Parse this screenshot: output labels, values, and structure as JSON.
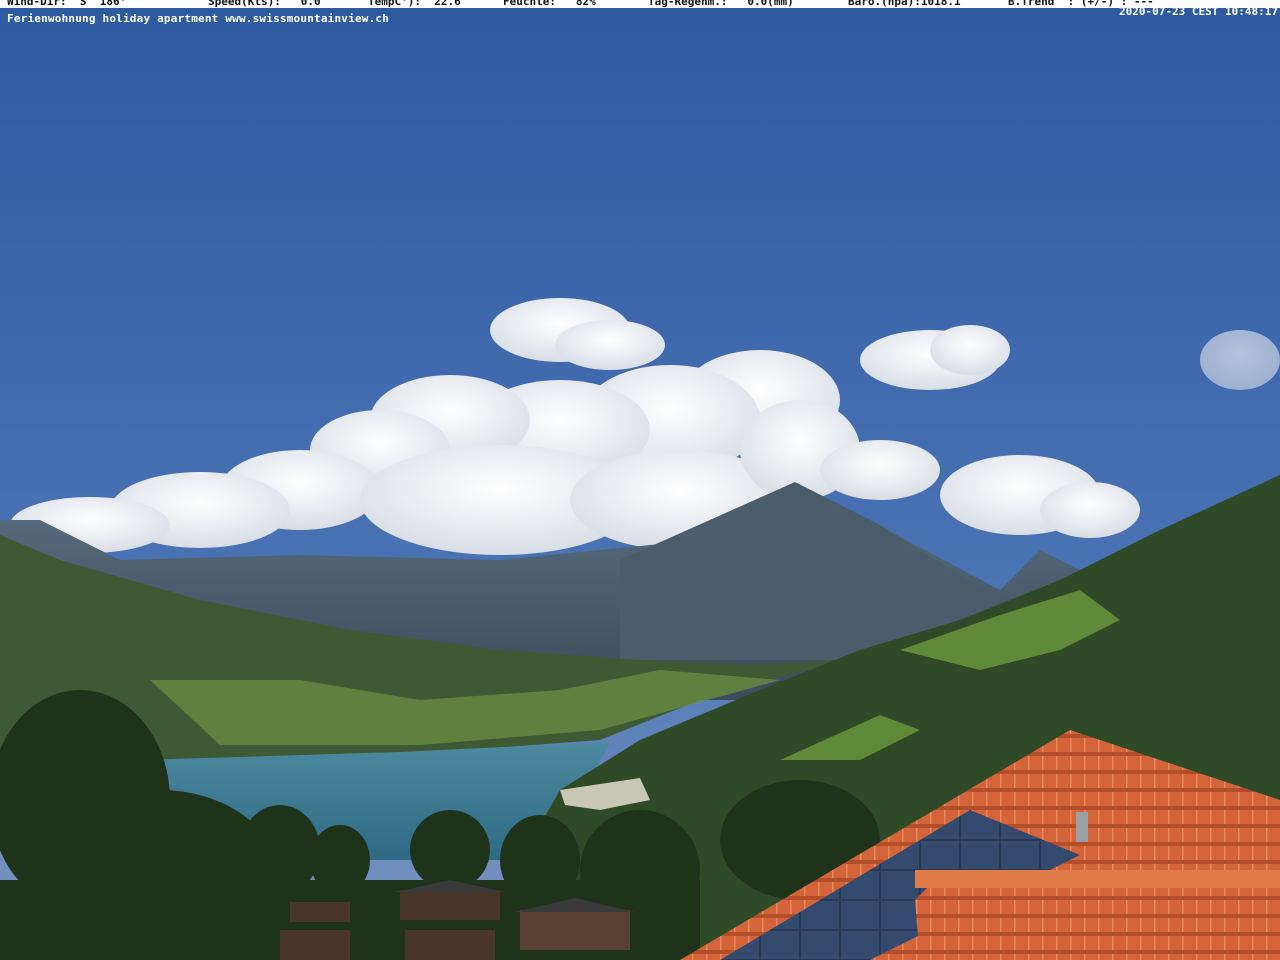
{
  "overlay": {
    "weather": {
      "wind_dir": "Wind-Dir:  S  186°",
      "speed": "Speed(Kts):   0.0",
      "temp": "TempC°):  22.6",
      "humidity": "Feuchte:   82%",
      "rain": "Tag-Regenm.:   0.0(mm)",
      "baro": "Baro.(hpa):1018.1",
      "trend": "B.Trend  : (+/-) : ---"
    },
    "site": "Ferienwohnung holiday apartment www.swissmountainview.ch",
    "timestamp": "2020-07-23 CEST 10:48:17"
  },
  "scene": {
    "sky": "#3a64a8",
    "cloud": "#f4f6fa",
    "lake": "#3f7e96",
    "forest": "#2c4a24",
    "meadow": "#5f8a3c",
    "roof_tile": "#d8673c",
    "solar_panel": "#2b3e5c"
  }
}
